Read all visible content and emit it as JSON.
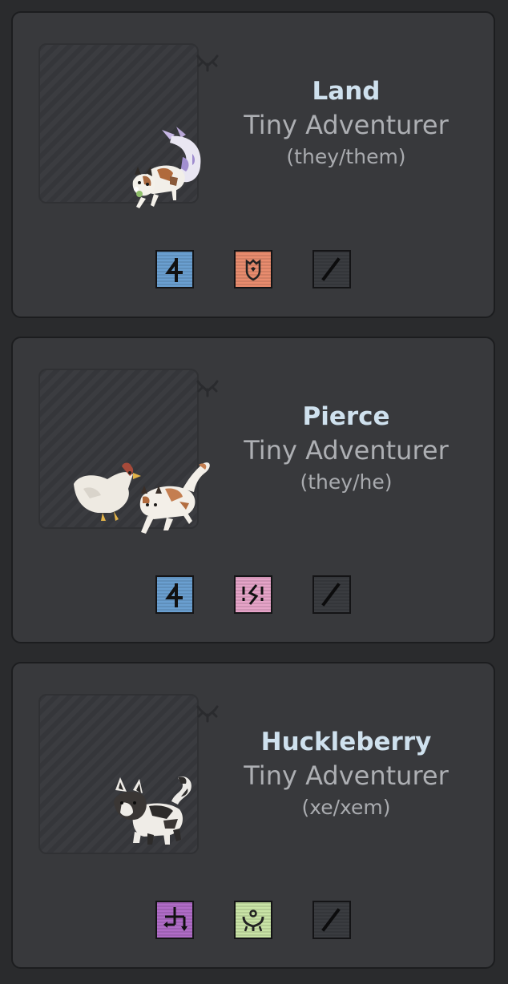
{
  "colors": {
    "background": "#2a2b2d",
    "card": "#38393c",
    "name_text": "#cfe1ee",
    "rank_text": "#adafb3"
  },
  "cards": [
    {
      "name": "Land",
      "rank": "Tiny Adventurer",
      "pronouns": "(they/them)",
      "sprite": "cat-with-fish-tail-sprite",
      "badges": [
        {
          "icon": "blue-rune-icon",
          "color": "#6a9fd0"
        },
        {
          "icon": "orange-shield-icon",
          "color": "#e98c6e"
        },
        {
          "icon": "slash-icon",
          "color": "#3a3c40"
        }
      ]
    },
    {
      "name": "Pierce",
      "rank": "Tiny Adventurer",
      "pronouns": "(they/he)",
      "sprite": "cat-with-chicken-sprite",
      "badges": [
        {
          "icon": "blue-rune-icon",
          "color": "#6a9fd0"
        },
        {
          "icon": "pink-lightning-icon",
          "color": "#e6a4c8"
        },
        {
          "icon": "slash-icon",
          "color": "#3a3c40"
        }
      ]
    },
    {
      "name": "Huckleberry",
      "rank": "Tiny Adventurer",
      "pronouns": "(xe/xem)",
      "sprite": "black-white-cat-sprite",
      "badges": [
        {
          "icon": "purple-arrows-icon",
          "color": "#b06cc7"
        },
        {
          "icon": "green-heart-hands-icon",
          "color": "#c9e4a6"
        },
        {
          "icon": "slash-icon",
          "color": "#3a3c40"
        }
      ]
    }
  ]
}
